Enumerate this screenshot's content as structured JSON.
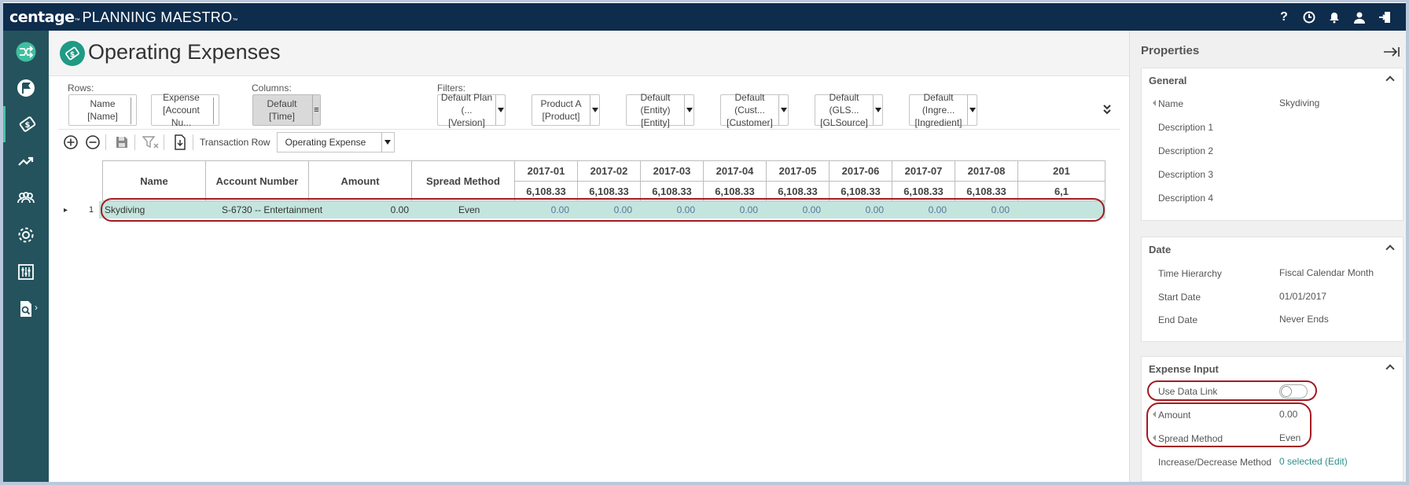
{
  "app": {
    "brand_name": "centage",
    "brand_tm": "™",
    "product": "PLANNING MAESTRO",
    "product_tm": "™"
  },
  "top_icons": [
    "help-icon",
    "clock-icon",
    "alerts-icon",
    "user-icon",
    "logout-icon"
  ],
  "nav": [
    "logo-icon",
    "flag-icon",
    "ticket-icon",
    "trend-icon",
    "team-icon",
    "gear-icon",
    "sliders-icon",
    "report-icon"
  ],
  "page": {
    "title": "Operating Expenses"
  },
  "layout": {
    "rows_label": "Rows:",
    "columns_label": "Columns:",
    "filters_label": "Filters:",
    "rows": [
      {
        "line1": "Name",
        "line2": "[Name]"
      },
      {
        "line1": "Expense",
        "line2": "[Account Nu..."
      }
    ],
    "columns": [
      {
        "line1": "Default",
        "line2": "[Time]"
      }
    ],
    "filters": [
      {
        "line1": "Default Plan (...",
        "line2": "[Version]"
      },
      {
        "line1": "Product A",
        "line2": "[Product]"
      },
      {
        "line1": "Default (Entity)",
        "line2": "[Entity]"
      },
      {
        "line1": "Default (Cust...",
        "line2": "[Customer]"
      },
      {
        "line1": "Default (GLS...",
        "line2": "[GLSource]"
      },
      {
        "line1": "Default (Ingre...",
        "line2": "[Ingredient]"
      }
    ]
  },
  "toolbar": {
    "transaction_row_label": "Transaction Row",
    "transaction_row_value": "Operating Expense"
  },
  "grid": {
    "headers": {
      "name": "Name",
      "account": "Account Number",
      "amount": "Amount",
      "spread": "Spread Method"
    },
    "months": [
      "2017-01",
      "2017-02",
      "2017-03",
      "2017-04",
      "2017-05",
      "2017-06",
      "2017-07",
      "2017-08",
      "201"
    ],
    "month_totals": [
      "6,108.33",
      "6,108.33",
      "6,108.33",
      "6,108.33",
      "6,108.33",
      "6,108.33",
      "6,108.33",
      "6,108.33",
      "6,1"
    ],
    "row": {
      "index": "1",
      "name": "Skydiving",
      "account": "S-6730 -- Entertainment",
      "amount": "0.00",
      "spread": "Even",
      "months": [
        "0.00",
        "0.00",
        "0.00",
        "0.00",
        "0.00",
        "0.00",
        "0.00",
        "0.00"
      ]
    }
  },
  "properties": {
    "title": "Properties",
    "general": {
      "title": "General",
      "name_key": "Name",
      "name_val": "Skydiving",
      "desc1": "Description 1",
      "desc2": "Description 2",
      "desc3": "Description 3",
      "desc4": "Description 4"
    },
    "date": {
      "title": "Date",
      "hierarchy_key": "Time Hierarchy",
      "hierarchy_val": "Fiscal Calendar Month",
      "start_key": "Start Date",
      "start_val": "01/01/2017",
      "end_key": "End Date",
      "end_val": "Never Ends"
    },
    "expense_input": {
      "title": "Expense Input",
      "use_data_link_key": "Use Data Link",
      "use_data_link_on": false,
      "amount_key": "Amount",
      "amount_val": "0.00",
      "spread_key": "Spread Method",
      "spread_val": "Even",
      "incdec_key": "Increase/Decrease Method",
      "incdec_val": "0 selected (Edit)"
    }
  },
  "colors": {
    "topbar": "#0e2c4c",
    "nav": "#24535d",
    "accent": "#1f9a84",
    "selected_row": "#c4e4de",
    "annotation": "#a31a22"
  }
}
